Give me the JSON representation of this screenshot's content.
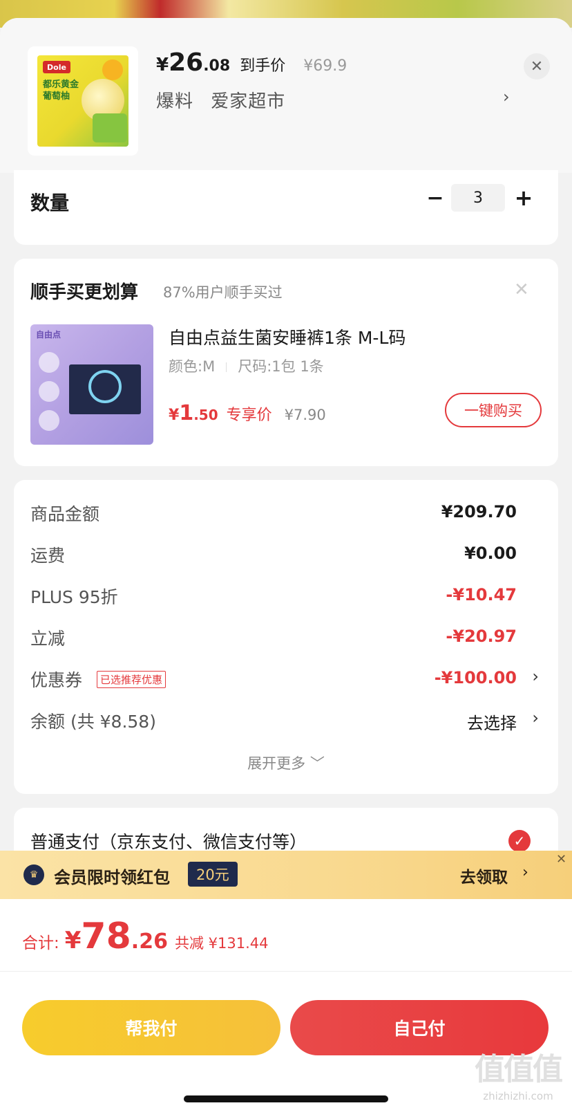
{
  "product": {
    "currency": "¥",
    "price_int": "26",
    "price_dec": ".08",
    "price_tag": "到手价",
    "original_price": "¥69.9",
    "sub_label": "爆料",
    "store": "爱家超市",
    "chevron": "›",
    "close": "✕",
    "image_brand": "Dole",
    "image_text": "都乐黄金\n葡萄柚"
  },
  "quantity": {
    "label": "数量",
    "minus": "−",
    "value": "3",
    "plus": "+"
  },
  "upsell": {
    "title": "顺手买更划算",
    "subtitle": "87%用户顺手买过",
    "close": "✕",
    "name": "自由点益生菌安睡裤1条 M-L码",
    "color_spec": "颜色:M",
    "size_spec": "尺码:1包 1条",
    "currency": "¥",
    "price_int": "1",
    "price_dec": ".50",
    "price_tag": "专享价",
    "original_price": "¥7.90",
    "buy_button": "一键购买",
    "image_brand": "自由点"
  },
  "summary": {
    "rows": [
      {
        "label": "商品金额",
        "value": "¥209.70"
      },
      {
        "label": "运费",
        "value": "¥0.00"
      },
      {
        "label": "PLUS 95折",
        "value": "-¥10.47"
      },
      {
        "label": "立减",
        "value": "-¥20.97"
      },
      {
        "label": "优惠券",
        "value": "-¥100.00",
        "tag": "已选推荐优惠"
      },
      {
        "label": "余额 (共 ¥8.58)",
        "value": "去选择"
      }
    ],
    "chevron": "›",
    "expand": "展开更多 ﹀"
  },
  "payment": {
    "label": "普通支付（京东支付、微信支付等）",
    "check": "✓"
  },
  "banner": {
    "icon": "♛",
    "text": "会员限时领红包",
    "badge": "20元",
    "action": "去领取",
    "chevron": "›",
    "close": "✕"
  },
  "bottom": {
    "total_label": "合计:",
    "currency": "¥",
    "total_int": "78",
    "total_dec": ".26",
    "saved": "共减 ¥131.44",
    "help_pay": "帮我付",
    "self_pay": "自己付"
  },
  "watermark": {
    "icon_text": "值值值",
    "site": "zhizhizhi.com"
  },
  "colors": {
    "accent_red": "#e4393c",
    "accent_yellow": "#f7cc2c",
    "banner_navy": "#1f2a4c"
  }
}
